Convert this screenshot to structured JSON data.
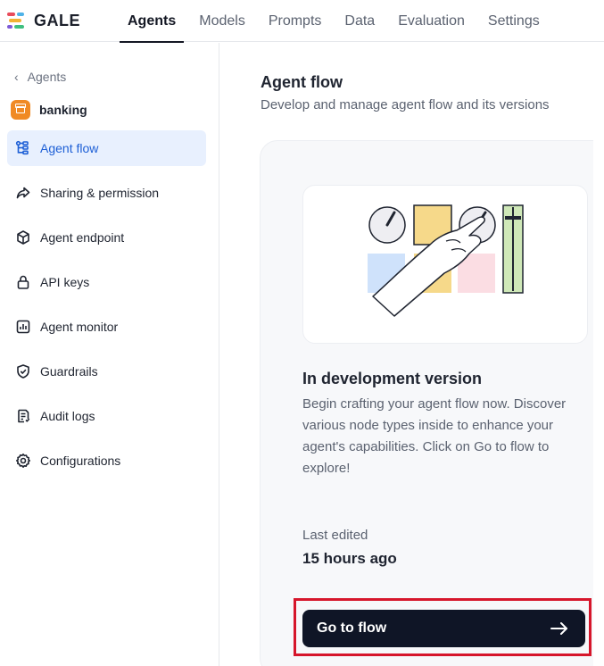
{
  "brand": {
    "name": "GALE"
  },
  "tabs": [
    {
      "label": "Agents",
      "active": true
    },
    {
      "label": "Models",
      "active": false
    },
    {
      "label": "Prompts",
      "active": false
    },
    {
      "label": "Data",
      "active": false
    },
    {
      "label": "Evaluation",
      "active": false
    },
    {
      "label": "Settings",
      "active": false
    }
  ],
  "sidebar": {
    "back_label": "Agents",
    "agent_name": "banking",
    "items": [
      {
        "label": "Agent flow",
        "icon": "flow-icon",
        "active": true
      },
      {
        "label": "Sharing & permission",
        "icon": "share-icon",
        "active": false
      },
      {
        "label": "Agent endpoint",
        "icon": "cube-icon",
        "active": false
      },
      {
        "label": "API keys",
        "icon": "lock-icon",
        "active": false
      },
      {
        "label": "Agent monitor",
        "icon": "monitor-chart-icon",
        "active": false
      },
      {
        "label": "Guardrails",
        "icon": "shield-check-icon",
        "active": false
      },
      {
        "label": "Audit logs",
        "icon": "document-icon",
        "active": false
      },
      {
        "label": "Configurations",
        "icon": "gear-icon",
        "active": false
      }
    ]
  },
  "main": {
    "title": "Agent flow",
    "subtitle": "Develop and manage agent flow and its versions",
    "card": {
      "title": "In development version",
      "description": "Begin crafting your agent flow now. Discover various node types inside to enhance your agent's capabilities. Click on Go to flow to explore!",
      "last_edited_label": "Last edited",
      "last_edited_value": "15 hours ago",
      "button_label": "Go to flow"
    }
  },
  "colors": {
    "accent": "#1d5fd6",
    "active_bg": "#e8f0fe",
    "button_bg": "#0f1526",
    "highlight_outline": "#d6162b",
    "brand_orange": "#f08a24"
  }
}
